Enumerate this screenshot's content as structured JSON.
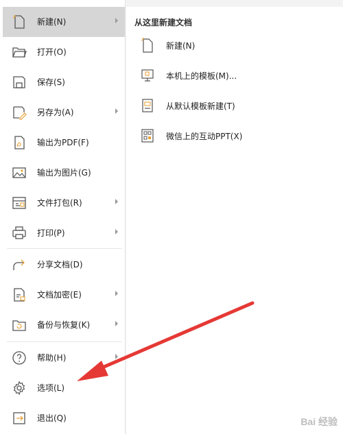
{
  "left_menu": {
    "items": [
      {
        "label": "新建(N)",
        "icon": "new-doc-icon",
        "has_submenu": true,
        "active": true
      },
      {
        "label": "打开(O)",
        "icon": "folder-open-icon",
        "has_submenu": false
      },
      {
        "label": "保存(S)",
        "icon": "save-icon",
        "has_submenu": false
      },
      {
        "label": "另存为(A)",
        "icon": "save-as-icon",
        "has_submenu": true
      },
      {
        "label": "输出为PDF(F)",
        "icon": "export-pdf-icon",
        "has_submenu": false
      },
      {
        "label": "输出为图片(G)",
        "icon": "export-image-icon",
        "has_submenu": false
      },
      {
        "label": "文件打包(R)",
        "icon": "package-icon",
        "has_submenu": true
      },
      {
        "label": "打印(P)",
        "icon": "print-icon",
        "has_submenu": true
      },
      {
        "label": "分享文档(D)",
        "icon": "share-icon",
        "has_submenu": false
      },
      {
        "label": "文档加密(E)",
        "icon": "encrypt-doc-icon",
        "has_submenu": true
      },
      {
        "label": "备份与恢复(K)",
        "icon": "backup-icon",
        "has_submenu": true
      },
      {
        "label": "帮助(H)",
        "icon": "help-icon",
        "has_submenu": true
      },
      {
        "label": "选项(L)",
        "icon": "gear-icon",
        "has_submenu": false
      },
      {
        "label": "退出(Q)",
        "icon": "exit-icon",
        "has_submenu": false
      }
    ]
  },
  "right_panel": {
    "title": "从这里新建文档",
    "items": [
      {
        "label": "新建(N)",
        "icon": "blank-doc-icon"
      },
      {
        "label": "本机上的模板(M)...",
        "icon": "local-template-icon"
      },
      {
        "label": "从默认模板新建(T)",
        "icon": "default-template-icon"
      },
      {
        "label": "微信上的互动PPT(X)",
        "icon": "wechat-ppt-icon"
      }
    ]
  },
  "annotation": {
    "color": "#e53935"
  },
  "watermark": {
    "text": "Bai 经验"
  }
}
